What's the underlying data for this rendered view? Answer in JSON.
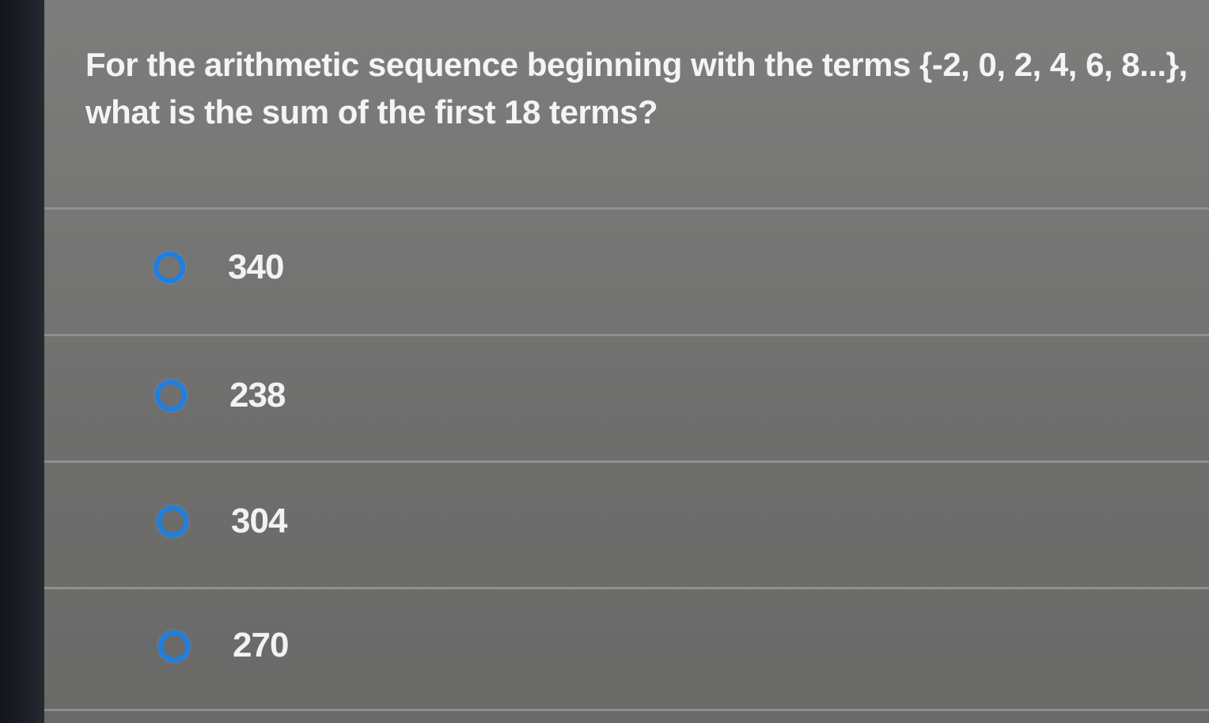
{
  "question": {
    "line1": "For the arithmetic sequence beginning with the terms {-2, 0, 2, 4, 6, 8...},",
    "line2": "what is the sum of the first 18 terms?"
  },
  "options": [
    {
      "label": "340"
    },
    {
      "label": "238"
    },
    {
      "label": "304"
    },
    {
      "label": "270"
    }
  ],
  "colors": {
    "radio_accent": "#1f7fe0",
    "background": "#767675",
    "text": "#f4f4f4"
  }
}
